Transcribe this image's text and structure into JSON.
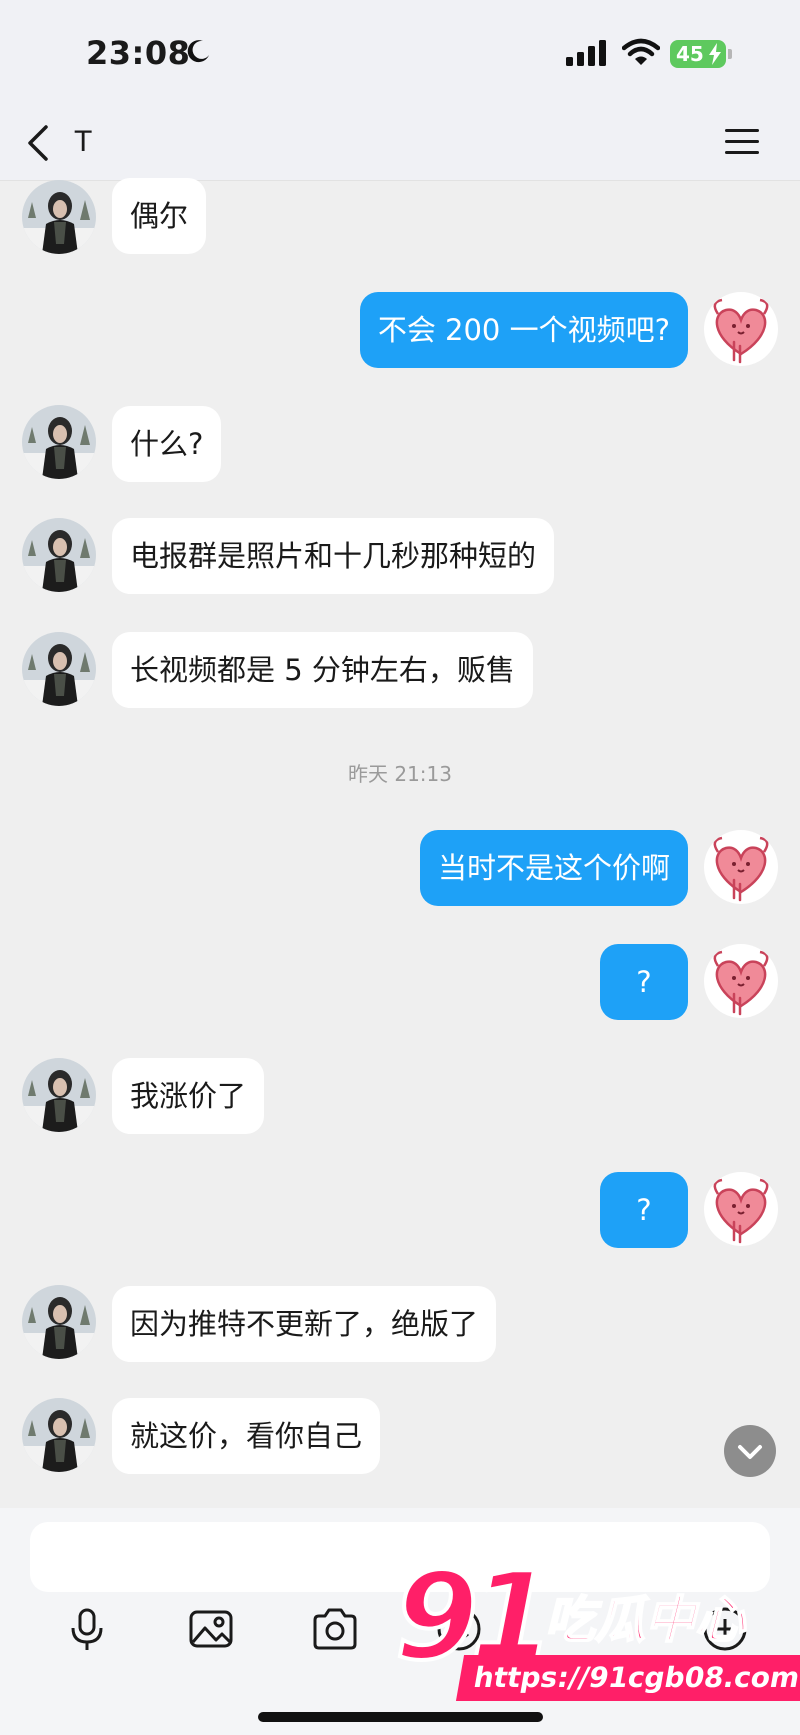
{
  "status_bar": {
    "time": "23:08",
    "battery": "45",
    "icons": [
      "moon-icon",
      "signal-icon",
      "wifi-icon",
      "battery-icon"
    ]
  },
  "header": {
    "contact_name": "T",
    "back_icon": "chevron-left-icon",
    "menu_icon": "hamburger-menu-icon"
  },
  "messages": [
    {
      "side": "in",
      "text": "偶尔"
    },
    {
      "side": "out",
      "text": "不会 200 一个视频吧?"
    },
    {
      "side": "in",
      "text": "什么?"
    },
    {
      "side": "in",
      "text": "电报群是照片和十几秒那种短的"
    },
    {
      "side": "in",
      "text": "长视频都是 5 分钟左右，贩售"
    },
    {
      "side": "out",
      "text": "当时不是这个价啊"
    },
    {
      "side": "out",
      "text": "?"
    },
    {
      "side": "in",
      "text": "我涨价了"
    },
    {
      "side": "out",
      "text": "?"
    },
    {
      "side": "in",
      "text": "因为推特不更新了，绝版了"
    },
    {
      "side": "in",
      "text": "就这价，看你自己"
    }
  ],
  "timestamp": "昨天 21:13",
  "composer": {
    "tools": [
      "microphone-icon",
      "image-icon",
      "camera-icon",
      "emoji-icon",
      "add-icon"
    ]
  },
  "watermark": {
    "number": "91",
    "brand": "吃瓜中心",
    "url": "https://91cgb08.com"
  },
  "colors": {
    "outgoing_bubble": "#1ea1f7",
    "incoming_bubble": "#ffffff",
    "background": "#efefef",
    "watermark": "#ff1f68"
  }
}
